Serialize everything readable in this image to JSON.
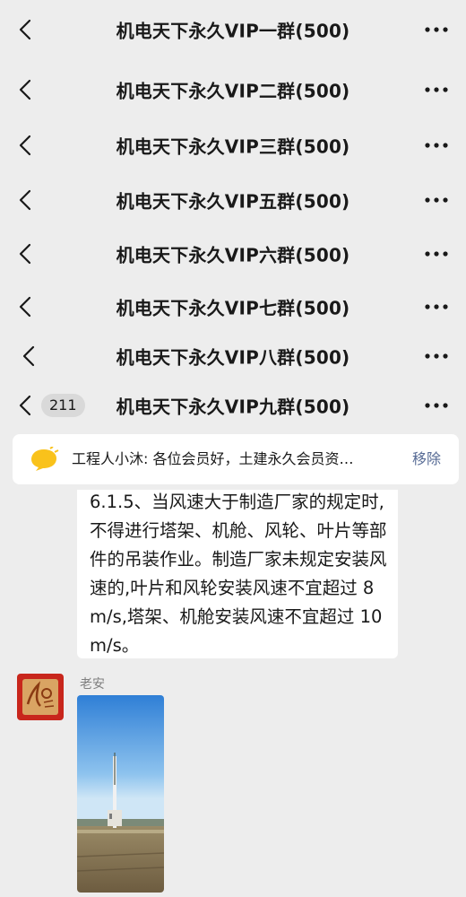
{
  "group_headers": [
    {
      "title": "机电天下永久VIP一群(500)"
    },
    {
      "title": "机电天下永久VIP二群(500)"
    },
    {
      "title": "机电天下永久VIP三群(500)"
    },
    {
      "title": "机电天下永久VIP五群(500)"
    },
    {
      "title": "机电天下永久VIP六群(500)"
    },
    {
      "title": "机电天下永久VIP七群(500)"
    },
    {
      "title": "机电天下永久VIP八群(500)"
    },
    {
      "title": "机电天下永久VIP九群(500)",
      "unread_count": "211"
    }
  ],
  "icons": {
    "back": "chevron-left-icon",
    "more": "more-dots-icon",
    "notice": "announcement-bubble-icon"
  },
  "notice": {
    "text": "工程人小沐: 各位会员好，土建永久会员资…",
    "action": "移除"
  },
  "message": {
    "text": "6.1.5、当风速大于制造厂家的规定时,不得进行塔架、机舱、风轮、叶片等部件的吊装作业。制造厂家未规定安装风速的,叶片和风轮安装风速不宜超过 8m/s,塔架、机舱安装风速不宜超过 10m/s。"
  },
  "sender": {
    "name": "老安"
  },
  "colors": {
    "background": "#ededed",
    "bubble": "#ffffff",
    "link": "#576b95",
    "notice_icon": "#f9c21b"
  }
}
